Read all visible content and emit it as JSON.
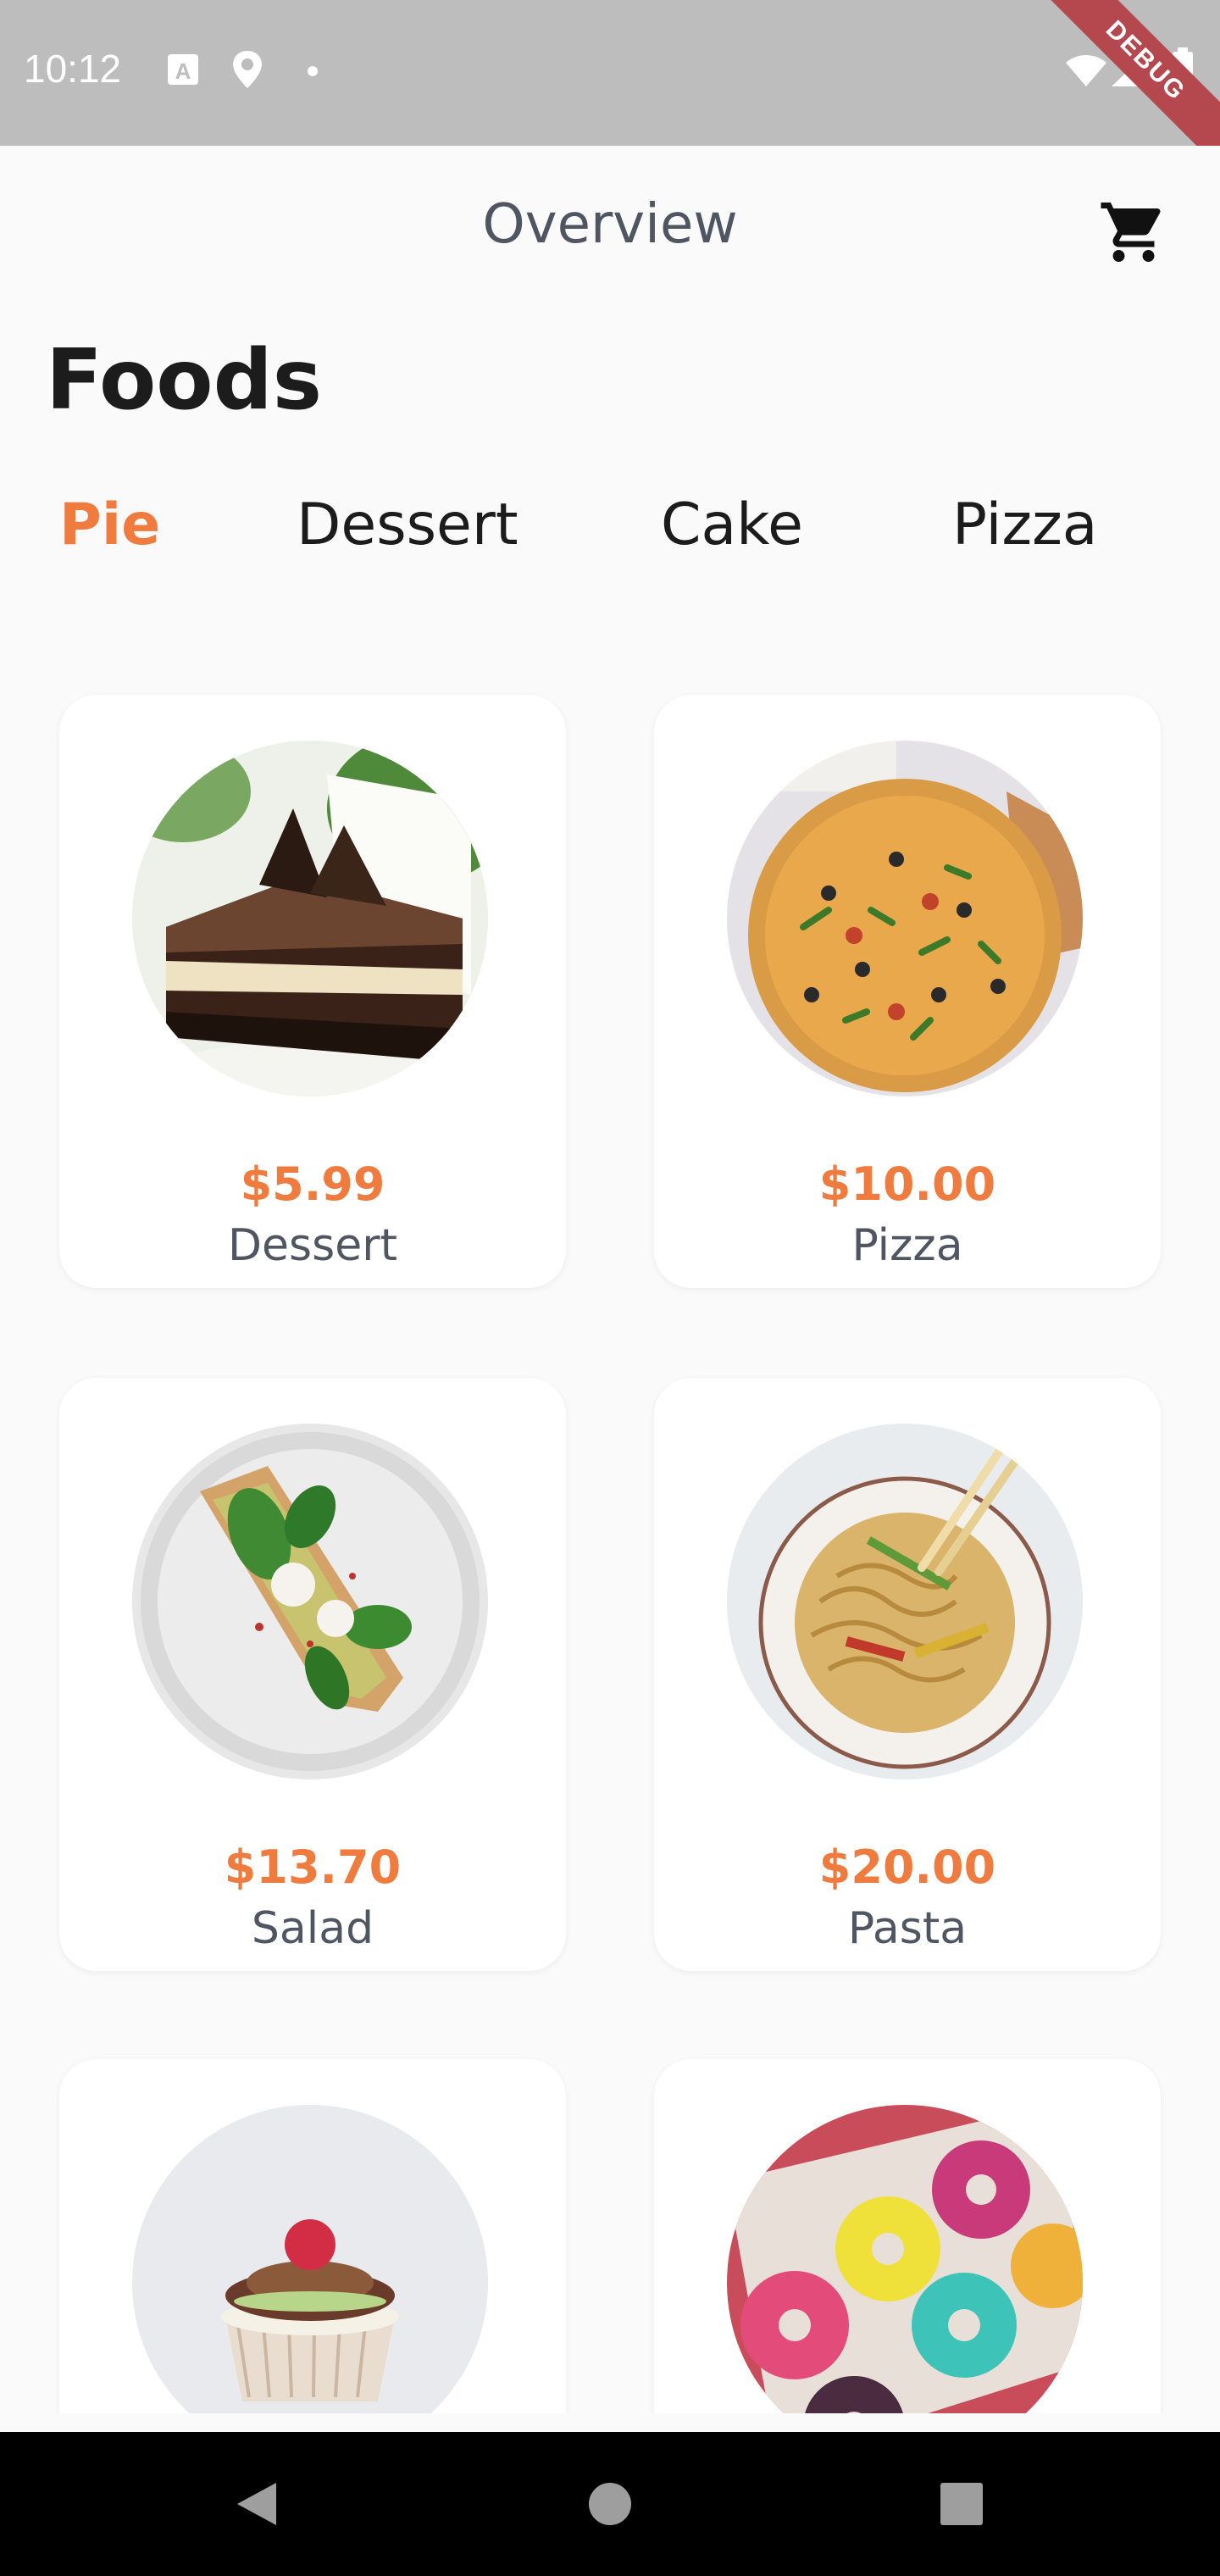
{
  "status_bar": {
    "time": "10:12",
    "debug_label": "DEBUG",
    "icons": [
      "keyboard-icon",
      "location-icon",
      "dot-icon",
      "wifi-icon",
      "signal-icon",
      "battery-icon"
    ]
  },
  "app_bar": {
    "title": "Overview",
    "cart_icon": "shopping-cart-icon"
  },
  "page": {
    "heading": "Foods"
  },
  "tabs": [
    {
      "label": "Pie",
      "active": true
    },
    {
      "label": "Dessert",
      "active": false
    },
    {
      "label": "Cake",
      "active": false
    },
    {
      "label": "Pizza",
      "active": false
    }
  ],
  "foods": [
    {
      "price": "$5.99",
      "name": "Dessert",
      "image": "chocolate-cake-slice"
    },
    {
      "price": "$10.00",
      "name": "Pizza",
      "image": "pizza"
    },
    {
      "price": "$13.70",
      "name": "Salad",
      "image": "avocado-toast-salad"
    },
    {
      "price": "$20.00",
      "name": "Pasta",
      "image": "noodles-bowl"
    },
    {
      "price": "",
      "name": "",
      "image": "cupcake"
    },
    {
      "price": "",
      "name": "",
      "image": "donuts-box"
    }
  ],
  "nav_bar": {
    "buttons": [
      "back-icon",
      "home-icon",
      "recents-icon"
    ]
  },
  "colors": {
    "accent": "#ef7b3e",
    "status_bar": "#bdbdbd",
    "background": "#fafafa",
    "card": "#ffffff",
    "text_dark": "#1c1c1c",
    "text_muted": "#4f5661"
  }
}
